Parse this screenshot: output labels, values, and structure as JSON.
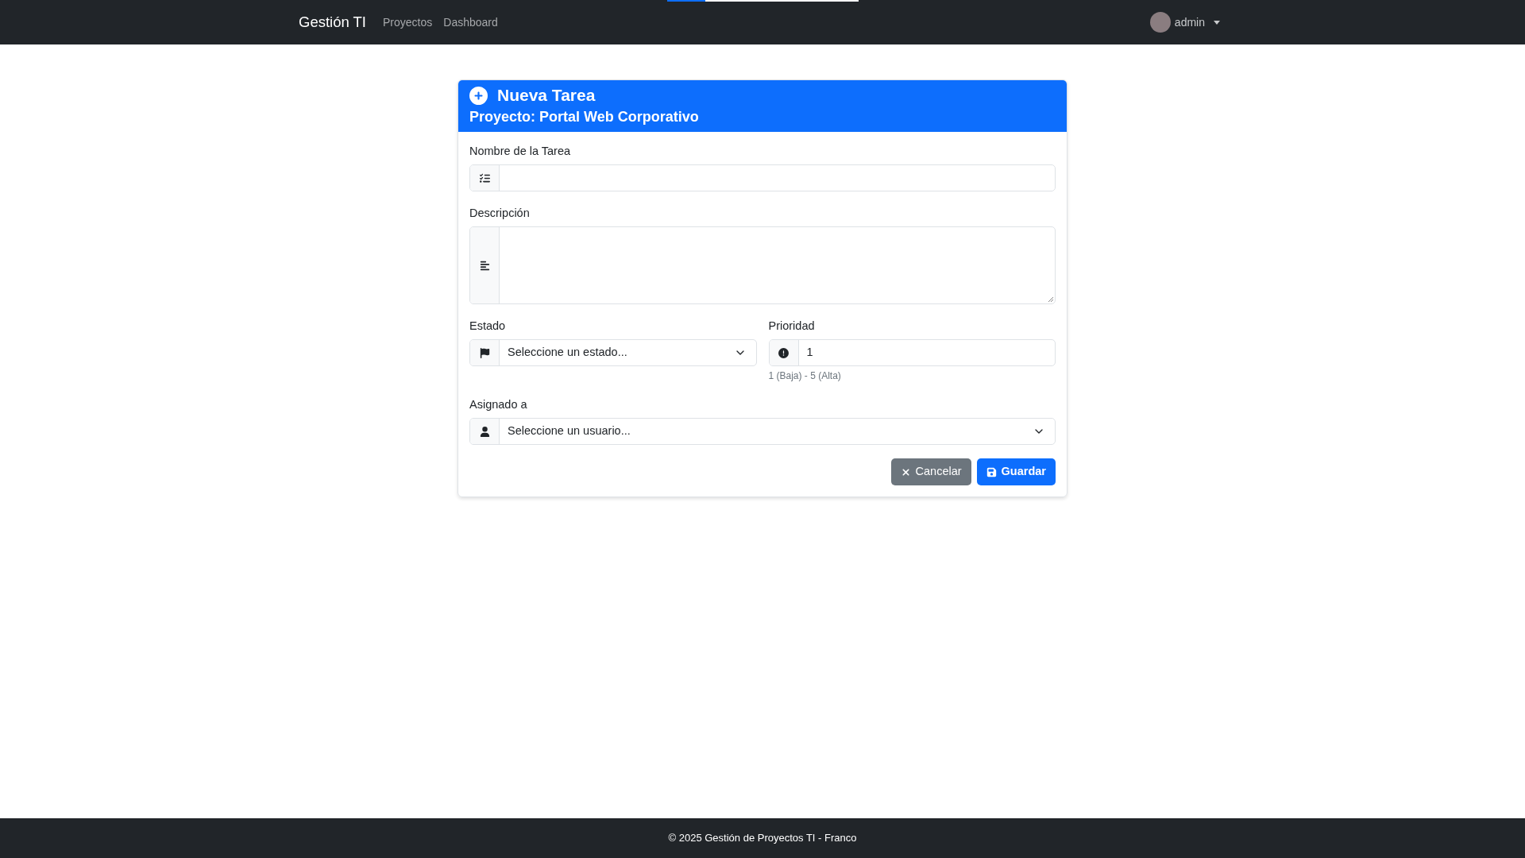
{
  "loading_bar": {
    "level": 0.2
  },
  "navbar": {
    "brand": "Gestión TI",
    "links": [
      "Proyectos",
      "Dashboard"
    ],
    "user": {
      "name": "admin"
    }
  },
  "card": {
    "title": "Nueva Tarea",
    "subtitle": "Proyecto: Portal Web Corporativo",
    "rows": [
      [
        {
          "kind": "text",
          "label": "Nombre de la Tarea"
        }
      ],
      [
        {
          "kind": "textarea",
          "label": "Descripción"
        }
      ],
      [
        {
          "kind": "select",
          "label": "Estado",
          "value": "Seleccione un estado..."
        },
        {
          "kind": "number",
          "label": "Prioridad",
          "value": "1",
          "help": "1 (Baja) - 5 (Alta)"
        }
      ],
      [
        {
          "kind": "select",
          "label": "Asignado a",
          "value": "Seleccione un usuario..."
        }
      ]
    ],
    "buttons": [
      {
        "kind": "secondary",
        "label": "Cancelar"
      },
      {
        "kind": "primary",
        "label": "Guardar"
      }
    ]
  },
  "footer": "© 2025 Gestión de Proyectos TI - Franco"
}
